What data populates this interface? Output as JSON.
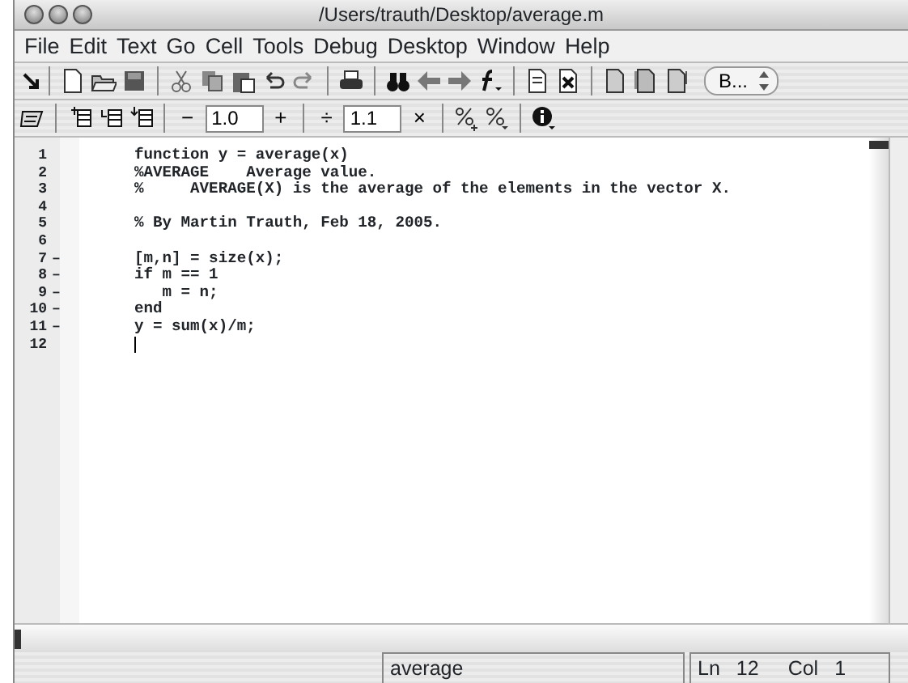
{
  "window": {
    "title": "/Users/trauth/Desktop/average.m"
  },
  "menu": [
    "File",
    "Edit",
    "Text",
    "Go",
    "Cell",
    "Tools",
    "Debug",
    "Desktop",
    "Window",
    "Help"
  ],
  "toolbar": {
    "stack_button": "B..."
  },
  "cell_toolbar": {
    "minus": "−",
    "decrement_value": "1.0",
    "plus": "+",
    "divide": "÷",
    "multiply_value": "1.1",
    "times": "×"
  },
  "editor": {
    "lines": [
      {
        "number": "1",
        "executable": false,
        "code": "function y = average(x)"
      },
      {
        "number": "2",
        "executable": false,
        "code": "%AVERAGE    Average value."
      },
      {
        "number": "3",
        "executable": false,
        "code": "%     AVERAGE(X) is the average of the elements in the vector X."
      },
      {
        "number": "4",
        "executable": false
      },
      {
        "number": "5",
        "executable": false,
        "code": "% By Martin Trauth, Feb 18, 2005."
      },
      {
        "number": "6",
        "executable": false
      },
      {
        "number": "7",
        "executable": true,
        "code": "[m,n] = size(x);"
      },
      {
        "number": "8",
        "executable": true,
        "code": "if m == 1"
      },
      {
        "number": "9",
        "executable": true,
        "code": "   m = n;"
      },
      {
        "number": "10",
        "executable": true,
        "code": "end"
      },
      {
        "number": "11",
        "executable": true,
        "code": "y = sum(x)/m;"
      },
      {
        "number": "12",
        "executable": false
      }
    ],
    "dash": "–"
  },
  "status_bar": {
    "function": "average",
    "ln_label": "Ln",
    "ln": "12",
    "col_label": "Col",
    "col": "1"
  }
}
